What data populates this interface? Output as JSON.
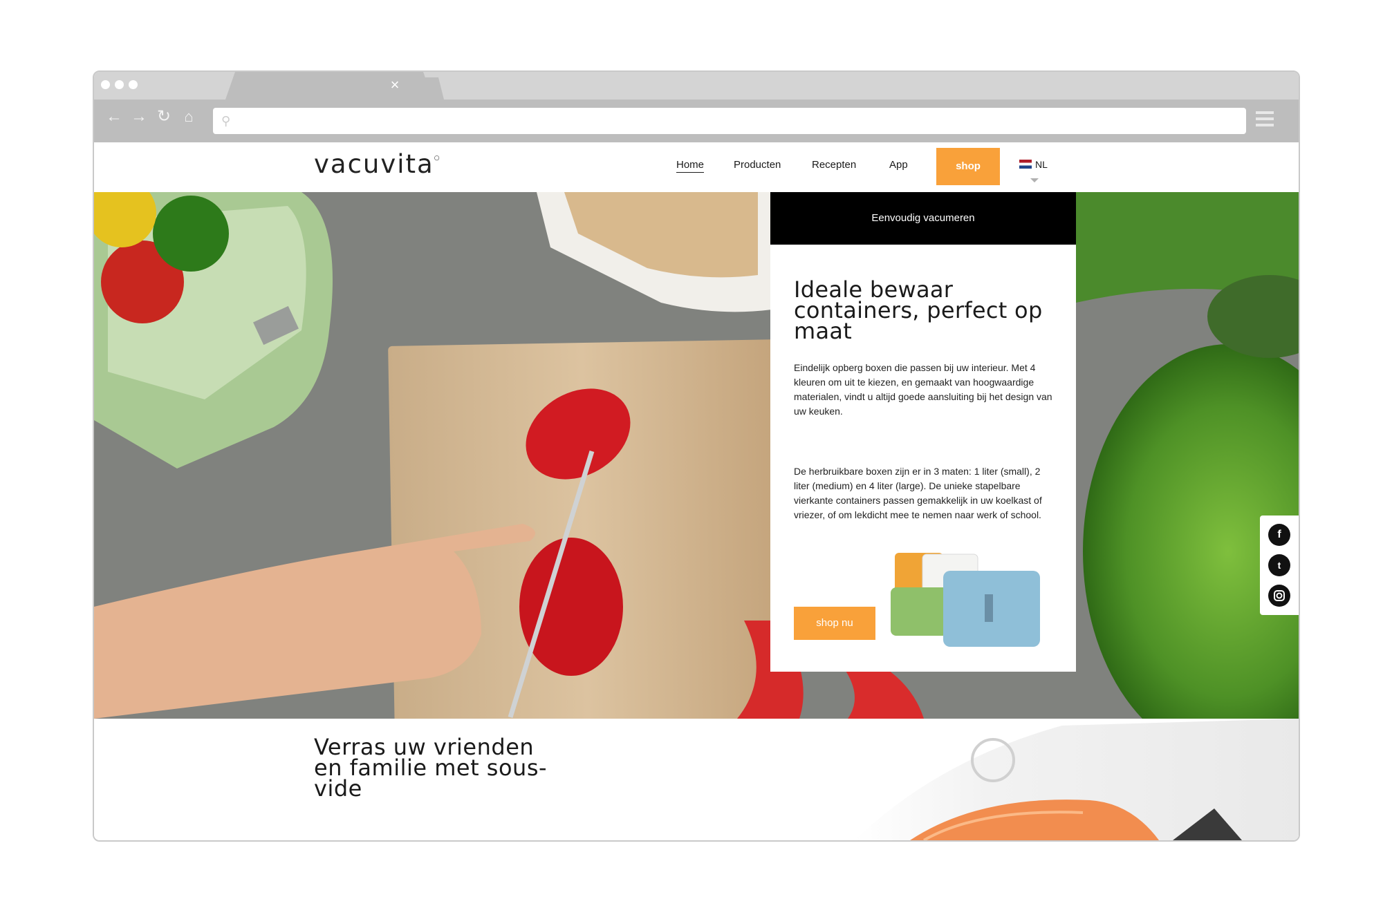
{
  "browser": {
    "tab_close": "×",
    "nav_icons": [
      "back-arrow-icon",
      "forward-arrow-icon",
      "reload-icon",
      "home-icon"
    ],
    "address_value": ""
  },
  "site": {
    "logo": "vacuvita",
    "nav": {
      "home": "Home",
      "producten": "Producten",
      "recepten": "Recepten",
      "app": "App"
    },
    "shop_label": "shop",
    "language": "NL",
    "accent_color": "#f9a13a"
  },
  "hero": {
    "panel_header": "Eenvoudig vacumeren",
    "title": "Ideale bewaar containers, perfect op maat",
    "paragraph1": "Eindelijk opberg boxen die passen bij uw interieur. Met 4 kleuren om uit te kiezen, en gemaakt van hoogwaardige materialen, vindt u altijd goede aansluiting bij het design van uw keuken.",
    "paragraph2": "De herbruikbare boxen zijn er in 3 maten: 1 liter (small), 2 liter (medium) en 4 liter (large). De unieke stapelbare vierkante containers passen gemakkelijk in uw koelkast of vriezer, of om lekdicht mee te nemen naar werk of school.",
    "cta_label": "shop nu"
  },
  "social": [
    "facebook-icon",
    "twitter-icon",
    "instagram-icon"
  ],
  "teaser": {
    "title": "Verras uw vrienden en familie met sous-vide"
  }
}
